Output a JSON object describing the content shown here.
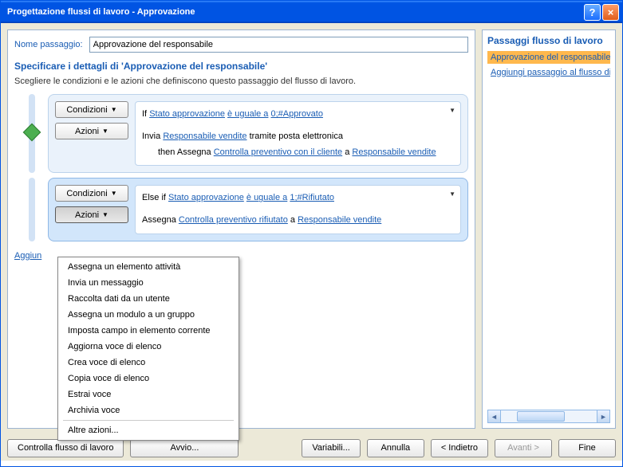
{
  "window": {
    "title": "Progettazione flussi di lavoro - Approvazione"
  },
  "stepName": {
    "label": "Nome passaggio:",
    "value": "Approvazione del responsabile"
  },
  "section": {
    "title": "Specificare i dettagli di 'Approvazione del responsabile'",
    "desc": "Scegliere le condizioni e le azioni che definiscono questo passaggio del flusso di lavoro."
  },
  "buttons": {
    "conditions": "Condizioni",
    "actions": "Azioni"
  },
  "block1": {
    "if": "If",
    "field": "Stato approvazione",
    "op": "è uguale a",
    "val": "0;#Approvato",
    "send": "Invia",
    "recipient": "Responsabile vendite",
    "via": "tramite posta elettronica",
    "then": "then Assegna",
    "task": "Controlla preventivo con il cliente",
    "to": "a",
    "assignee": "Responsabile vendite"
  },
  "block2": {
    "elseif": "Else if",
    "field": "Stato approvazione",
    "op": "è uguale a",
    "val": "1;#Rifiutato",
    "assign": "Assegna",
    "task": "Controlla preventivo rifiutato",
    "to": "a",
    "assignee": "Responsabile vendite"
  },
  "addBranch": "Aggiun",
  "menu": {
    "items": [
      "Assegna un elemento attività",
      "Invia un messaggio",
      "Raccolta dati da un utente",
      "Assegna un modulo a un gruppo",
      "Imposta campo in elemento corrente",
      "Aggiorna voce di elenco",
      "Crea voce di elenco",
      "Copia voce di elenco",
      "Estrai voce",
      "Archivia voce"
    ],
    "more": "Altre azioni..."
  },
  "side": {
    "title": "Passaggi flusso di lavoro",
    "selected": "Approvazione del responsabile",
    "addLink": "Aggiungi passaggio al flusso di lav"
  },
  "footer": {
    "check": "Controlla flusso di lavoro",
    "start": "Avvio...",
    "vars": "Variabili...",
    "cancel": "Annulla",
    "back": "< Indietro",
    "next": "Avanti >",
    "finish": "Fine"
  }
}
